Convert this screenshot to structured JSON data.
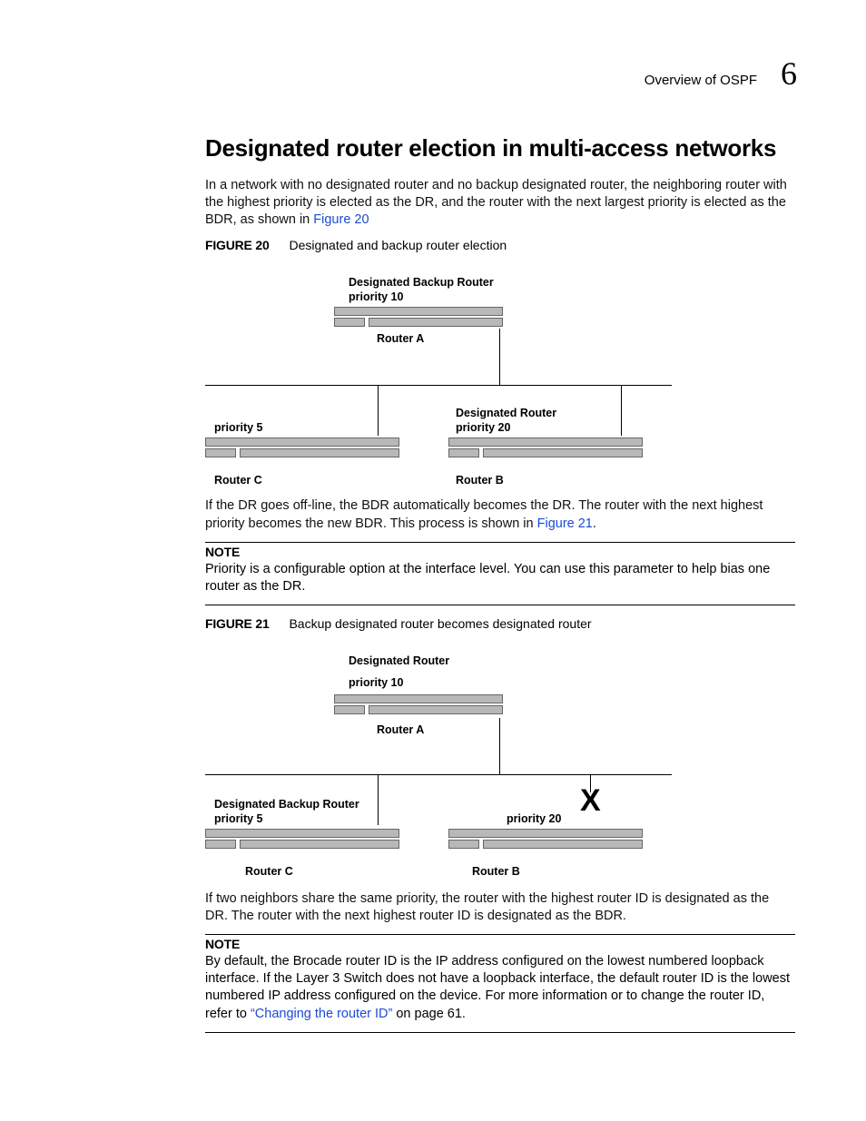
{
  "header": {
    "overview": "Overview of OSPF",
    "chapter": "6"
  },
  "section_title": "Designated router election in multi-access networks",
  "intro": {
    "text_a": "In a network with no designated router and no backup designated router, the neighboring router with the highest priority is elected as the DR, and the router with the next largest priority is elected as the BDR, as shown in ",
    "link": "Figure 20"
  },
  "fig20": {
    "label": "FIGURE 20",
    "title": "Designated and backup router election",
    "labels": {
      "dbr": "Designated Backup Router",
      "p10": "priority 10",
      "ra": "Router A",
      "p5": "priority 5",
      "rc": "Router C",
      "dr": "Designated Router",
      "p20": "priority 20",
      "rb": "Router B"
    }
  },
  "para2": {
    "text_a": "If the DR goes off-line, the BDR automatically becomes the DR. The router with the next highest priority becomes the new BDR. This process is shown in ",
    "link": "Figure 21",
    "text_b": "."
  },
  "note1": {
    "label": "NOTE",
    "body": "Priority is a configurable option at the interface level. You can use this parameter to help bias one router as the DR."
  },
  "fig21": {
    "label": "FIGURE 21",
    "title": "Backup designated router becomes designated router",
    "labels": {
      "dr": "Designated Router",
      "p10": "priority 10",
      "ra": "Router A",
      "dbr": "Designated Backup Router",
      "p5": "priority 5",
      "rc": "Router C",
      "p20": "priority 20",
      "rb": "Router B",
      "x": "X"
    }
  },
  "para3": "If two neighbors share the same priority, the router with the highest router ID is designated as the DR. The router with the next highest router ID is designated as the BDR.",
  "note2": {
    "label": "NOTE",
    "body_a": "By default, the Brocade router ID is the IP address configured on the lowest numbered loopback interface. If the Layer 3 Switch does not have a loopback interface, the default router ID is the lowest numbered IP address configured on the device. For more information or to change the router ID, refer to ",
    "link": "“Changing the router ID”",
    "body_b": " on page 61."
  }
}
